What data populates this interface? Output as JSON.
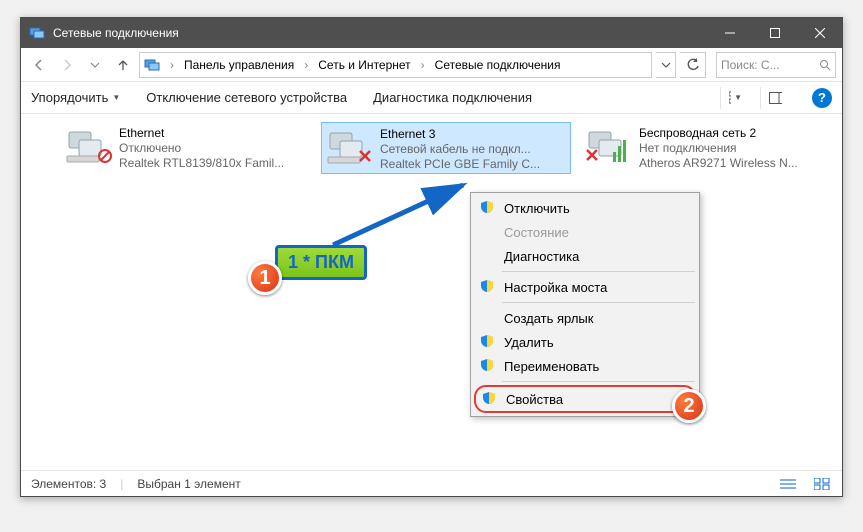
{
  "window": {
    "title": "Сетевые подключения"
  },
  "breadcrumb": {
    "parts": [
      "Панель управления",
      "Сеть и Интернет",
      "Сетевые подключения"
    ]
  },
  "search": {
    "placeholder": "Поиск: С..."
  },
  "toolbar": {
    "organize": "Упорядочить",
    "disable_device": "Отключение сетевого устройства",
    "diagnose": "Диагностика подключения"
  },
  "adapters": [
    {
      "name": "Ethernet",
      "status": "Отключено",
      "device": "Realtek RTL8139/810x Famil..."
    },
    {
      "name": "Ethernet 3",
      "status": "Сетевой кабель не подкл...",
      "device": "Realtek PCIe GBE Family C..."
    },
    {
      "name": "Беспроводная сеть 2",
      "status": "Нет подключения",
      "device": "Atheros AR9271 Wireless N..."
    }
  ],
  "context_menu": {
    "disable": "Отключить",
    "status": "Состояние",
    "diagnose": "Диагностика",
    "bridge": "Настройка моста",
    "shortcut": "Создать ярлык",
    "delete": "Удалить",
    "rename": "Переименовать",
    "properties": "Свойства"
  },
  "annotation": {
    "rmb_hint": "1 * ПКМ",
    "badge1": "1",
    "badge2": "2"
  },
  "statusbar": {
    "count_label": "Элементов: 3",
    "selection_label": "Выбран 1 элемент"
  }
}
